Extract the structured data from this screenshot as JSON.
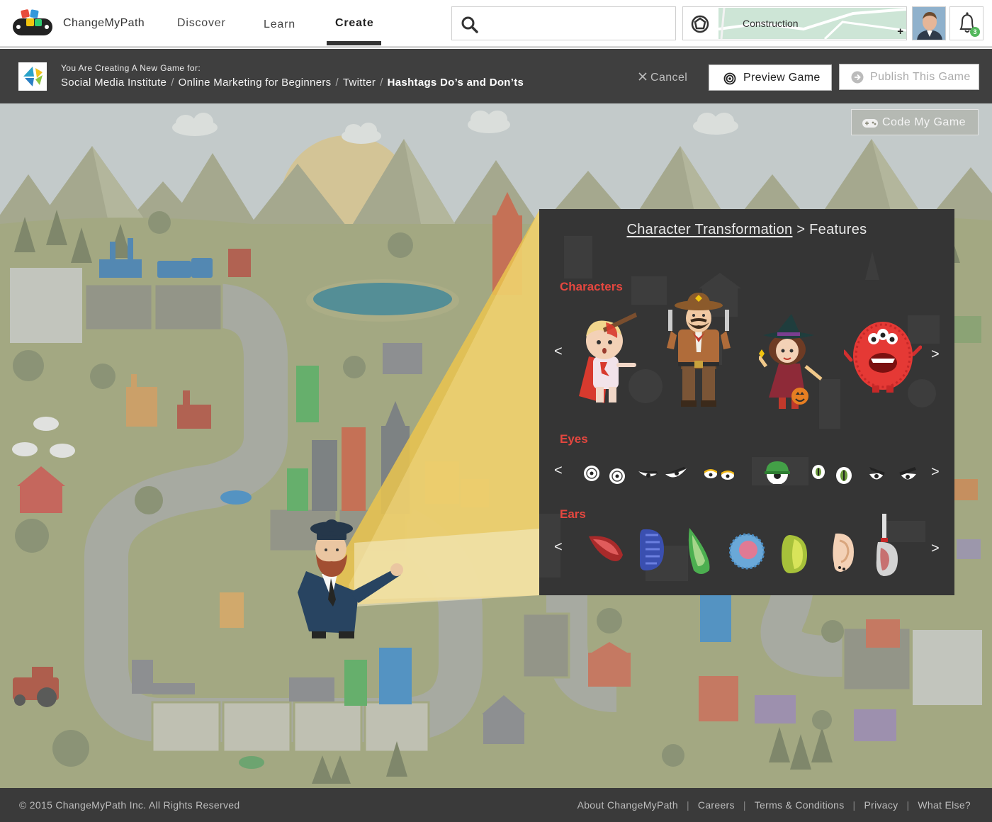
{
  "nav": {
    "brand": "ChangeMyPath",
    "links": [
      "Discover",
      "Learn",
      "Create"
    ],
    "active": "Create",
    "search_placeholder": "",
    "path_label": "Construction",
    "path_add": "+",
    "notifications_count": "3"
  },
  "subheader": {
    "creating_label": "You Are Creating A New Game for:",
    "breadcrumb": [
      "Social Media Institute",
      "Online Marketing for Beginners",
      "Twitter"
    ],
    "current": "Hashtags Do’s and Don’ts",
    "separator": "/",
    "cancel_label": "Cancel",
    "preview_label": "Preview Game",
    "publish_label": "Publish This Game"
  },
  "canvas": {
    "code_my_game_label": "Code My Game"
  },
  "panel": {
    "title_link": "Character Transformation",
    "title_rest": " > Features",
    "sections": {
      "characters": "Characters",
      "eyes": "Eyes",
      "ears": "Ears"
    },
    "prev": "<",
    "next": ">",
    "characters": [
      "hurt-boy-character",
      "cowboy-character",
      "witch-girl-character",
      "red-monster-character"
    ],
    "eyes": [
      "round-eyes",
      "angry-eyes",
      "sleepy-eyes",
      "helmet-eye",
      "green-eyes",
      "narrow-eyes"
    ],
    "ears": [
      "red-ear",
      "blue-ear",
      "green-ear",
      "round-ear",
      "yellow-ear",
      "human-ear",
      "knife-ear"
    ],
    "colors": {
      "accent": "#e5473f",
      "panel_bg": "#353535"
    }
  },
  "footer": {
    "copyright": "© 2015 ChangeMyPath Inc. All Rights Reserved",
    "links": [
      "About ChangeMyPath",
      "Careers",
      "Terms & Conditions",
      "Privacy",
      "What Else?"
    ],
    "separator": "|"
  }
}
